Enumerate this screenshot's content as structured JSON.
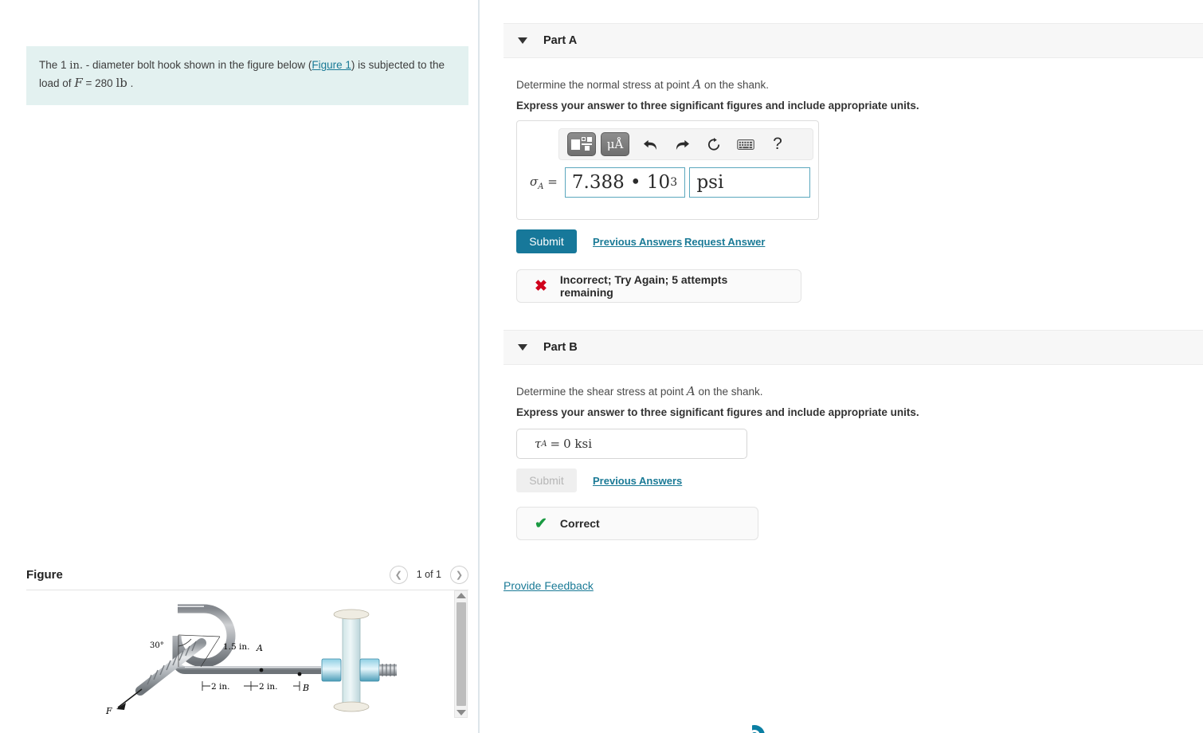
{
  "problem": {
    "text_before": "The 1",
    "unit_in": "in.",
    "text_mid": "- diameter bolt hook shown in the figure below (",
    "figure_link": "Figure 1",
    "text_after": ") is subjected to the load of",
    "force_symbol": "F",
    "equals": "= 280",
    "force_unit": "lb",
    "period": "."
  },
  "figure": {
    "title": "Figure",
    "counter": "1 of 1",
    "prev_icon": "chevron-left-icon",
    "next_icon": "chevron-right-icon",
    "labels": {
      "angle": "30°",
      "radius": "1.5 in.",
      "point_a": "A",
      "point_b": "B",
      "dim1": "2 in.",
      "dim2": "2 in.",
      "force": "F"
    }
  },
  "parts": [
    {
      "id": "part-a",
      "label": "Part A",
      "caret_icon": "caret-down-icon",
      "prompt_before": "Determine the normal stress at point",
      "prompt_var": "A",
      "prompt_after": "on the shank.",
      "instruction": "Express your answer to three significant figures and include appropriate units.",
      "toolbar": {
        "template_icon": "math-template-icon",
        "units_icon": "micro-angstrom-units-icon",
        "units_text": "μÅ",
        "undo_icon": "undo-arrow-icon",
        "redo_icon": "redo-arrow-icon",
        "reset_icon": "reset-circle-icon",
        "keyboard_icon": "keyboard-icon",
        "help_icon": "help-question-icon",
        "help_text": "?"
      },
      "answer": {
        "symbol": "σ",
        "subscript": "A",
        "equals": "=",
        "value_mantissa": "7.388 • 10",
        "value_exponent": "3",
        "units_value": "psi"
      },
      "submit_label": "Submit",
      "submit_disabled": false,
      "previous_answers_label": "Previous Answers",
      "request_answer_label": "Request Answer",
      "feedback": {
        "icon": "x-mark-icon",
        "status": "incorrect",
        "text": "Incorrect; Try Again; 5 attempts remaining"
      }
    },
    {
      "id": "part-b",
      "label": "Part B",
      "caret_icon": "caret-down-icon",
      "prompt_before": "Determine the shear stress at point",
      "prompt_var": "A",
      "prompt_after": "on the shank.",
      "instruction": "Express your answer to three significant figures and include appropriate units.",
      "answer": {
        "symbol": "τ",
        "subscript": "A",
        "equals": "=",
        "value": "0 ksi"
      },
      "submit_label": "Submit",
      "submit_disabled": true,
      "previous_answers_label": "Previous Answers",
      "feedback": {
        "icon": "check-mark-icon",
        "status": "correct",
        "text": "Correct"
      }
    }
  ],
  "provide_feedback_label": "Provide Feedback",
  "colors": {
    "accent": "#17789a",
    "link": "#1a7a96",
    "problem_bg": "#e3f1f0",
    "part_header_bg": "#f7f7f7",
    "incorrect": "#d0021b",
    "correct": "#1a9a42",
    "field_border": "#5ba7bd"
  },
  "scrollbar": {
    "up_icon": "scroll-up-arrow-icon",
    "down_icon": "scroll-down-arrow-icon"
  }
}
